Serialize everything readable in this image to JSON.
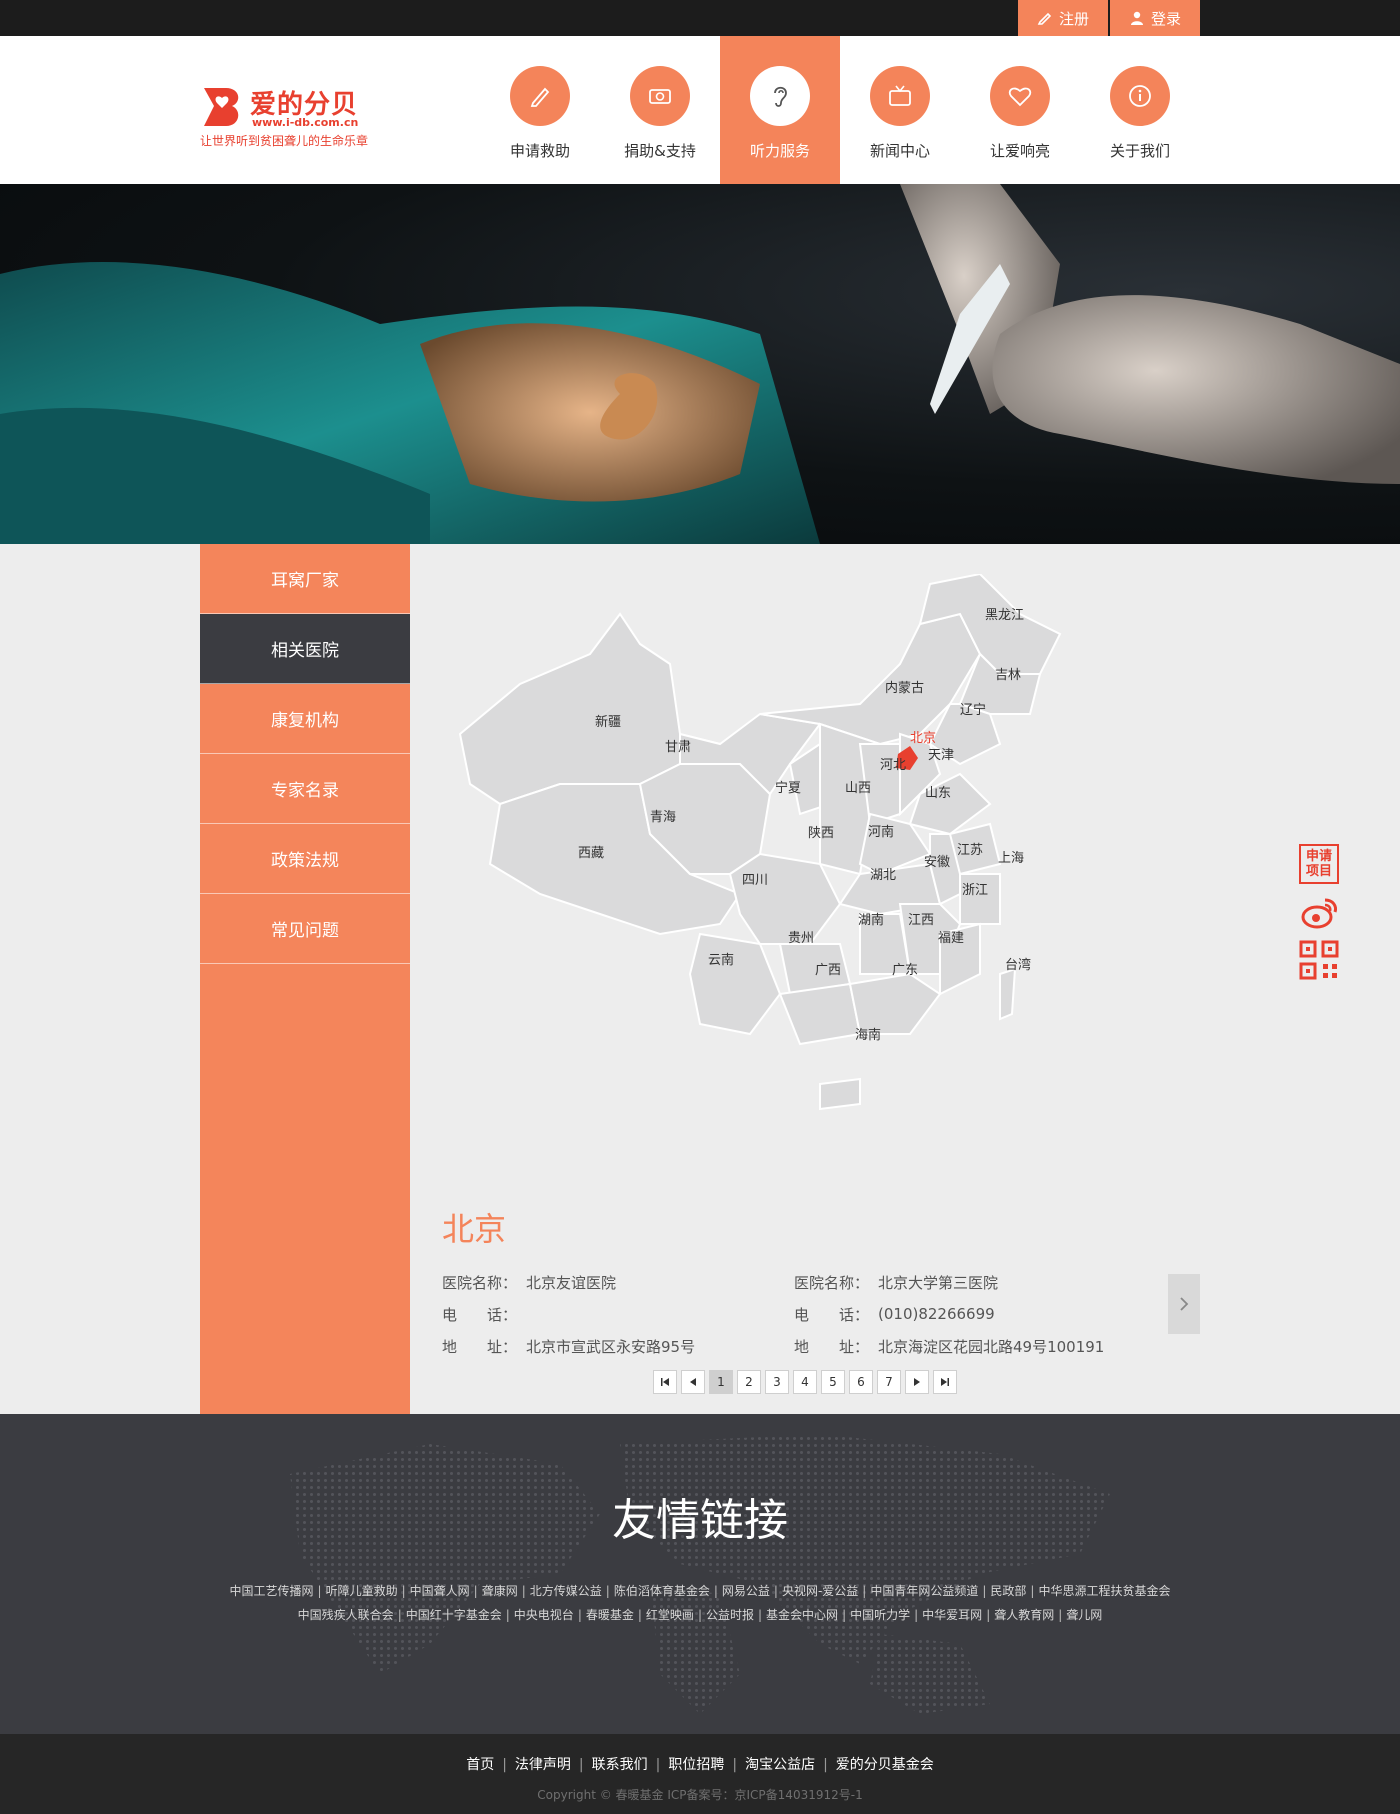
{
  "top": {
    "register": "注册",
    "login": "登录"
  },
  "brand": {
    "name": "爱的分贝",
    "url": "www.i-db.com.cn",
    "slogan": "让世界听到贫困聋儿的生命乐章"
  },
  "nav": [
    {
      "label": "申请救助",
      "icon": "pencil-icon"
    },
    {
      "label": "捐助&支持",
      "icon": "money-icon"
    },
    {
      "label": "听力服务",
      "icon": "ear-icon",
      "active": true
    },
    {
      "label": "新闻中心",
      "icon": "tv-icon"
    },
    {
      "label": "让爱响亮",
      "icon": "heart-icon"
    },
    {
      "label": "关于我们",
      "icon": "info-icon"
    }
  ],
  "sidebar": [
    {
      "label": "耳窝厂家"
    },
    {
      "label": "相关医院",
      "active": true
    },
    {
      "label": "康复机构"
    },
    {
      "label": "专家名录"
    },
    {
      "label": "政策法规"
    },
    {
      "label": "常见问题"
    }
  ],
  "map": {
    "labels": [
      "黑龙江",
      "吉林",
      "内蒙古",
      "辽宁",
      "北京",
      "天津",
      "新疆",
      "甘肃",
      "河北",
      "宁夏",
      "山西",
      "山东",
      "青海",
      "陕西",
      "河南",
      "江苏",
      "上海",
      "西藏",
      "安徽",
      "四川",
      "湖北",
      "浙江",
      "湖南",
      "江西",
      "贵州",
      "福建",
      "云南",
      "广西",
      "广东",
      "台湾",
      "海南"
    ],
    "selected": "北京"
  },
  "detail": {
    "city": "北京",
    "hospitals": [
      {
        "name_key": "医院名称：",
        "name": "北京友谊医院",
        "tel_key": "电　　话：",
        "tel": "",
        "addr_key": "地　　址：",
        "addr": "北京市宣武区永安路95号"
      },
      {
        "name_key": "医院名称：",
        "name": "北京大学第三医院",
        "tel_key": "电　　话：",
        "tel": "(010)82266699",
        "addr_key": "地　　址：",
        "addr": "北京海淀区花园北路49号100191"
      }
    ],
    "pages": [
      "1",
      "2",
      "3",
      "4",
      "5",
      "6",
      "7"
    ],
    "current_page": "1"
  },
  "float": {
    "apply": "申请项目"
  },
  "friend_links": {
    "title": "友情链接",
    "row1": [
      "中国工艺传播网",
      "听障儿童救助",
      "中国聋人网",
      "聋康网",
      "北方传媒公益",
      "陈伯滔体育基金会",
      "网易公益",
      "央视网-爱公益",
      "中国青年网公益频道",
      "民政部",
      "中华思源工程扶贫基金会"
    ],
    "row2": [
      "中国残疾人联合会",
      "中国红十字基金会",
      "中央电视台",
      "春暖基金",
      "红堂映画",
      "公益时报",
      "基金会中心网",
      "中国听力学",
      "中华爱耳网",
      "聋人教育网",
      "聋儿网"
    ]
  },
  "footer": {
    "nav": [
      "首页",
      "法律声明",
      "联系我们",
      "职位招聘",
      "淘宝公益店",
      "爱的分贝基金会"
    ],
    "copyright": "Copyright © 春暖基金 ICP备案号：京ICP备14031912号-1"
  },
  "colors": {
    "accent": "#f4845a",
    "dark": "#3b3c41",
    "brand_red": "#e8402f"
  }
}
